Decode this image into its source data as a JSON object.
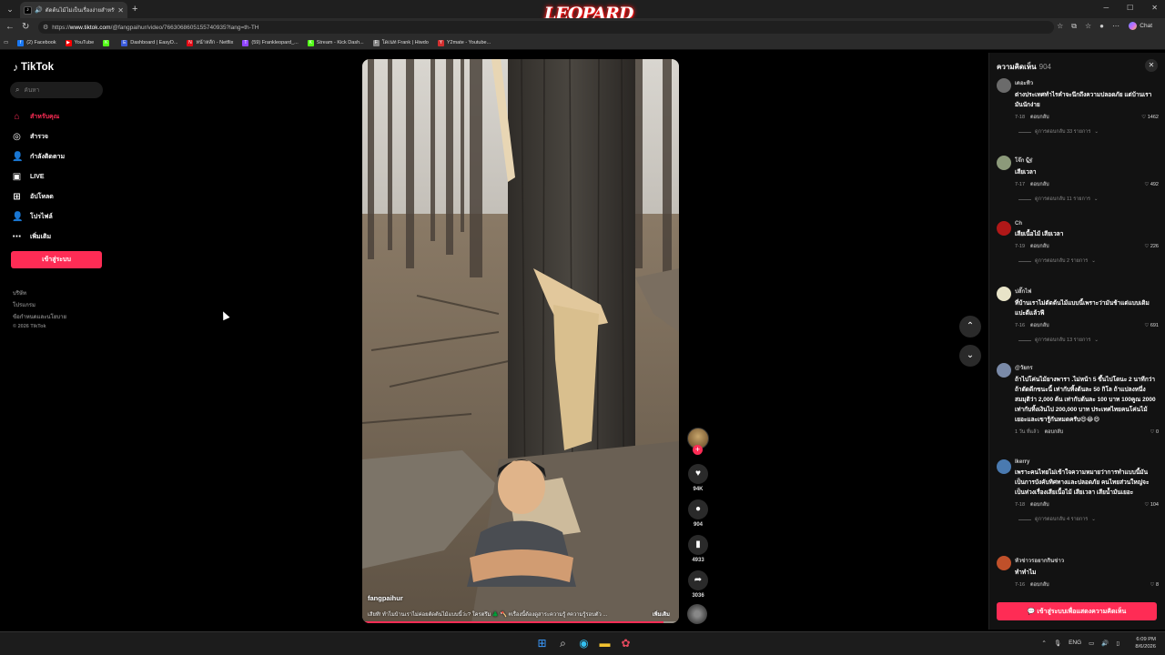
{
  "browser": {
    "tab_title": "ตัดต้นไม้ไม่เป็นเรื่องง่ายสำหรับคุณ",
    "brand_overlay": "LEOPARD",
    "url_prefix": "https://",
    "url_host": "www.tiktok.com",
    "url_path": "/@fangpaihur/video/7663068605155740935?lang=th-TH",
    "chat_label": "Chat",
    "bookmarks": [
      {
        "label": "(2) Facebook",
        "icon": "facebook-icon",
        "color": "#1877f2",
        "glyph": "f"
      },
      {
        "label": "YouTube",
        "icon": "youtube-icon",
        "color": "#ff0000",
        "glyph": "▶"
      },
      {
        "label": "",
        "icon": "kick-icon",
        "color": "#53fc18",
        "glyph": "K"
      },
      {
        "label": "Dashboard | EasyD...",
        "icon": "dashboard-icon",
        "color": "#3b5bdb",
        "glyph": "E"
      },
      {
        "label": "หน้าหลัก - Netflix",
        "icon": "netflix-icon",
        "color": "#e50914",
        "glyph": "N"
      },
      {
        "label": "(59) Frankleopard_...",
        "icon": "twitch-icon",
        "color": "#9146ff",
        "glyph": "T"
      },
      {
        "label": "Stream - Kick Dash...",
        "icon": "kick-icon",
        "color": "#53fc18",
        "glyph": "K"
      },
      {
        "label": "โดเนท Frank | Hiwdo",
        "icon": "hiwdo-icon",
        "color": "#888888",
        "glyph": "F"
      },
      {
        "label": "Y2mate - Youtube...",
        "icon": "y2mate-icon",
        "color": "#d32f2f",
        "glyph": "Y"
      }
    ]
  },
  "sidebar": {
    "logo": "TikTok",
    "search_placeholder": "ค้นหา",
    "items": [
      {
        "label": "สำหรับคุณ",
        "icon": "home-icon",
        "active": true
      },
      {
        "label": "สำรวจ",
        "icon": "compass-icon",
        "active": false
      },
      {
        "label": "กำลังติดตาม",
        "icon": "following-icon",
        "active": false
      },
      {
        "label": "LIVE",
        "icon": "live-icon",
        "active": false
      },
      {
        "label": "อัปโหลด",
        "icon": "upload-icon",
        "active": false
      },
      {
        "label": "โปรไฟล์",
        "icon": "profile-icon",
        "active": false
      },
      {
        "label": "เพิ่มเติม",
        "icon": "more-icon",
        "active": false
      }
    ],
    "login_label": "เข้าสู่ระบบ",
    "footer": [
      "บริษัท",
      "โปรแกรม",
      "ข้อกำหนดและนโยบาย"
    ],
    "copyright": "© 2026 TikTok"
  },
  "video": {
    "author": "fangpaihur",
    "caption": "เสียที! ทำไมบ้านเราไม่ค่อยตัดต้นไม้แบบนี้ว่ะ? ใครตรึม 🌲 🪓 #เรื่องนี้ต้องดูสาระความรู้ #ความรู้รอบตัว ...",
    "more_label": "เพิ่มเติม",
    "progress": 0.95
  },
  "actions": {
    "likes": "94K",
    "comments": "904",
    "saves": "4933",
    "shares": "3036"
  },
  "comments_panel": {
    "title": "ความคิดเห็น",
    "count": "904",
    "login_label": "เข้าสู่ระบบเพื่อแสดงความคิดเห็น",
    "items": [
      {
        "user": "เดอะทิว",
        "text": "ต่างประเทศทำไรคำจะนึกถึงความปลอดภัย แต่บ้านเรามันนักง่าย",
        "date": "7-18",
        "reply": "ตอบกลับ",
        "likes": "1462",
        "replies": "ดูการตอบกลับ 33 รายการ",
        "avatar": "#6b6b6b"
      },
      {
        "user": "โจ๊ก 🐿",
        "text": "เสียเวลา",
        "date": "7-17",
        "reply": "ตอบกลับ",
        "likes": "492",
        "replies": "ดูการตอบกลับ 11 รายการ",
        "avatar": "#8c9a7a"
      },
      {
        "user": "Ch",
        "text": "เสียเนื้อไม้ เสียเวลา",
        "date": "7-19",
        "reply": "ตอบกลับ",
        "likes": "226",
        "replies": "ดูการตอบกลับ 2 รายการ",
        "avatar": "#b01818"
      },
      {
        "user": "ปลั๊กไฟ",
        "text": "ที่บ้านเราไม่ตัดต้นไม้แบบนี้เพราะว่ามันช้าแต่แบบเดิมแปะตีแล้วฟี",
        "date": "7-16",
        "reply": "ตอบกลับ",
        "likes": "691",
        "replies": "ดูการตอบกลับ 13 รายการ",
        "avatar": "#e8e4c8"
      },
      {
        "user": "@วัยกร",
        "text": "ถ้าไปโค่นไม้ยางพารา .ไม่หน้า 5 ขึ้นไปโดนะ 2 นาทีกว่า ถ้าตัดดีกขนะนี้ เท่ากับทิ้งต้นละ 50 กิโล ถ้าแปลงหนึ่งสมมุติว่า 2,000 ต้น เท่ากับต้นละ 100 บาท 100คูณ 2000 เท่ากับทิ้งเงินไป 200,000 บาท ประเทศไทยคนโค่นไม้เยอะและเขารู้กันหมดครับ😄😂😄",
        "date": "1 วัน ที่แล้ว",
        "reply": "ตอบกลับ",
        "likes": "0",
        "replies": "",
        "avatar": "#7a8aa8"
      },
      {
        "user": "Ikerry",
        "text": "เพราะคนไทยไม่เข้าใจความหมายว่าการทำแบบนี้มันเป็นการบังคับทิศทางและปลอดภัย คนไทยส่วนใหญ่จะเป็นห่วงเรื่องเสียเนื้อไม้ เสียเวลา เสียน้ำมันเยอะ",
        "date": "7-18",
        "reply": "ตอบกลับ",
        "likes": "104",
        "replies": "ดูการตอบกลับ 4 รายการ",
        "avatar": "#4a7ab0"
      },
      {
        "user": "หัวข่าวรอยากกินข่าว",
        "text": "ทำทำไม",
        "date": "7-16",
        "reply": "ตอบกลับ",
        "likes": "8",
        "replies": "",
        "avatar": "#c0502a"
      }
    ]
  },
  "taskbar": {
    "lang": "ENG",
    "time": "6:09 PM",
    "date": "8/6/2026"
  }
}
